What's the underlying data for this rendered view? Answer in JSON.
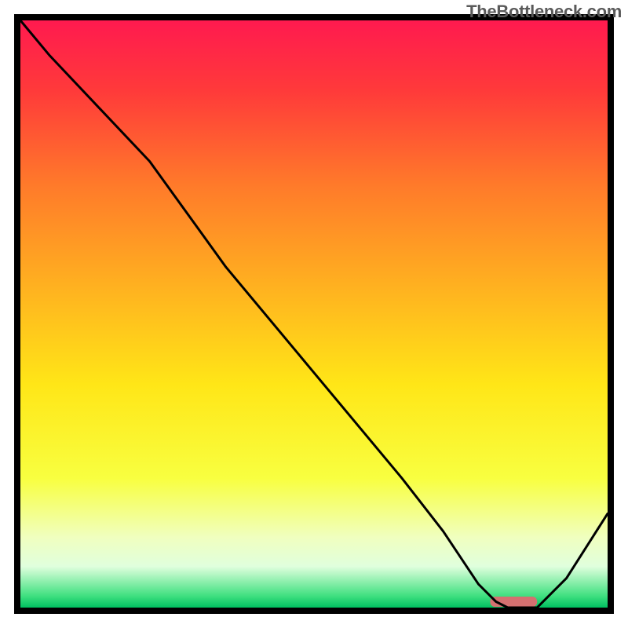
{
  "attribution": "TheBottleneck.com",
  "chart_data": {
    "type": "line",
    "title": "",
    "xlabel": "",
    "ylabel": "",
    "xlim": [
      0,
      100
    ],
    "ylim": [
      0,
      100
    ],
    "series": [
      {
        "name": "bottleneck-curve",
        "x": [
          0,
          5,
          22,
          35,
          50,
          65,
          72,
          78,
          81,
          83,
          88,
          93,
          100
        ],
        "values": [
          100,
          94,
          76,
          58,
          40,
          22,
          13,
          4,
          1,
          0,
          0,
          5,
          16
        ]
      }
    ],
    "marker": {
      "name": "optimal-range",
      "x_start": 80,
      "x_end": 88,
      "color": "#d47070"
    },
    "background_gradient": {
      "stops": [
        {
          "offset": 0.0,
          "color": "#ff1a4f"
        },
        {
          "offset": 0.12,
          "color": "#ff3a3a"
        },
        {
          "offset": 0.28,
          "color": "#ff7a2a"
        },
        {
          "offset": 0.45,
          "color": "#ffb020"
        },
        {
          "offset": 0.62,
          "color": "#ffe617"
        },
        {
          "offset": 0.78,
          "color": "#f8ff40"
        },
        {
          "offset": 0.88,
          "color": "#f0ffbf"
        },
        {
          "offset": 0.93,
          "color": "#e0ffdd"
        },
        {
          "offset": 0.98,
          "color": "#40e080"
        },
        {
          "offset": 1.0,
          "color": "#00c060"
        }
      ]
    },
    "frame_color": "#000000",
    "frame_width": 8,
    "curve_color": "#000000",
    "curve_width": 3
  }
}
